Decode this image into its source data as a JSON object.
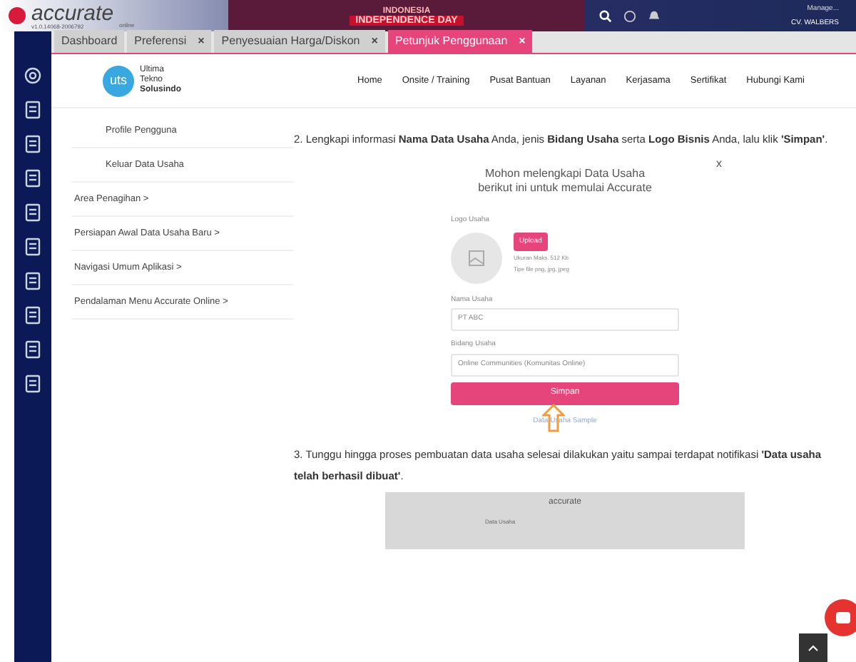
{
  "app": {
    "logo": "accurate",
    "logo_sub": "online",
    "version": "v1.0.14068-2006792",
    "banner_top": "INDONESIA",
    "banner_bottom": "INDEPENDENCE DAY",
    "notice": "Manage...",
    "company": "CV. WALBERS"
  },
  "tabs": [
    {
      "label": "Dashboard",
      "closable": false,
      "selected": false
    },
    {
      "label": "Preferensi",
      "closable": true,
      "selected": false
    },
    {
      "label": "Penyesuaian Harga/Diskon",
      "closable": true,
      "selected": false
    },
    {
      "label": "Petunjuk Penggunaan",
      "closable": true,
      "selected": true
    }
  ],
  "close_glyph": "×",
  "site": {
    "logo_mark": "uts",
    "name_lines": [
      "Ultima",
      "Tekno",
      "Solusindo"
    ],
    "nav": [
      "Home",
      "Onsite / Training",
      "Pusat Bantuan",
      "Layanan",
      "Kerjasama",
      "Sertifikat",
      "Hubungi Kami"
    ]
  },
  "menu": [
    {
      "label": "Profile Pengguna",
      "sub": true
    },
    {
      "label": "Keluar Data Usaha",
      "sub": true
    },
    {
      "label": "Area Penagihan >",
      "sub": false
    },
    {
      "label": "Persiapan Awal Data Usaha Baru >",
      "sub": false
    },
    {
      "label": "Navigasi Umum Aplikasi >",
      "sub": false
    },
    {
      "label": "Pendalaman Menu Accurate Online >",
      "sub": false
    }
  ],
  "step2": "2. Lengkapi informasi **Nama Data Usaha** Anda, jenis **Bidang Usaha** serta **Logo Bisnis** Anda, lalu klik **'Simpan'**.",
  "dialog": {
    "close": "x",
    "title": "Mohon melengkapi Data Usaha berikut ini untuk memulai Accurate",
    "logo_label": "Logo Usaha",
    "upload": "Upload",
    "hint_lines": [
      "Ukuran Maks. 512 Kb",
      "Tipe file png, jpg, jpeg"
    ],
    "name_label": "Nama Usaha",
    "name_value": "PT ABC",
    "field_label": "Bidang Usaha",
    "field_value": "Online Communities (Komunitas Online)",
    "save": "Simpan",
    "sample_link": "Data Usaha Sample"
  },
  "step3": "3. Tunggu hingga proses pembuatan data usaha selesai dilakukan yaitu sampai terdapat notifikasi **'Data usaha telah berhasil dibuat'**.",
  "shot": {
    "logo": "accurate",
    "tab": "Data Usaha"
  }
}
